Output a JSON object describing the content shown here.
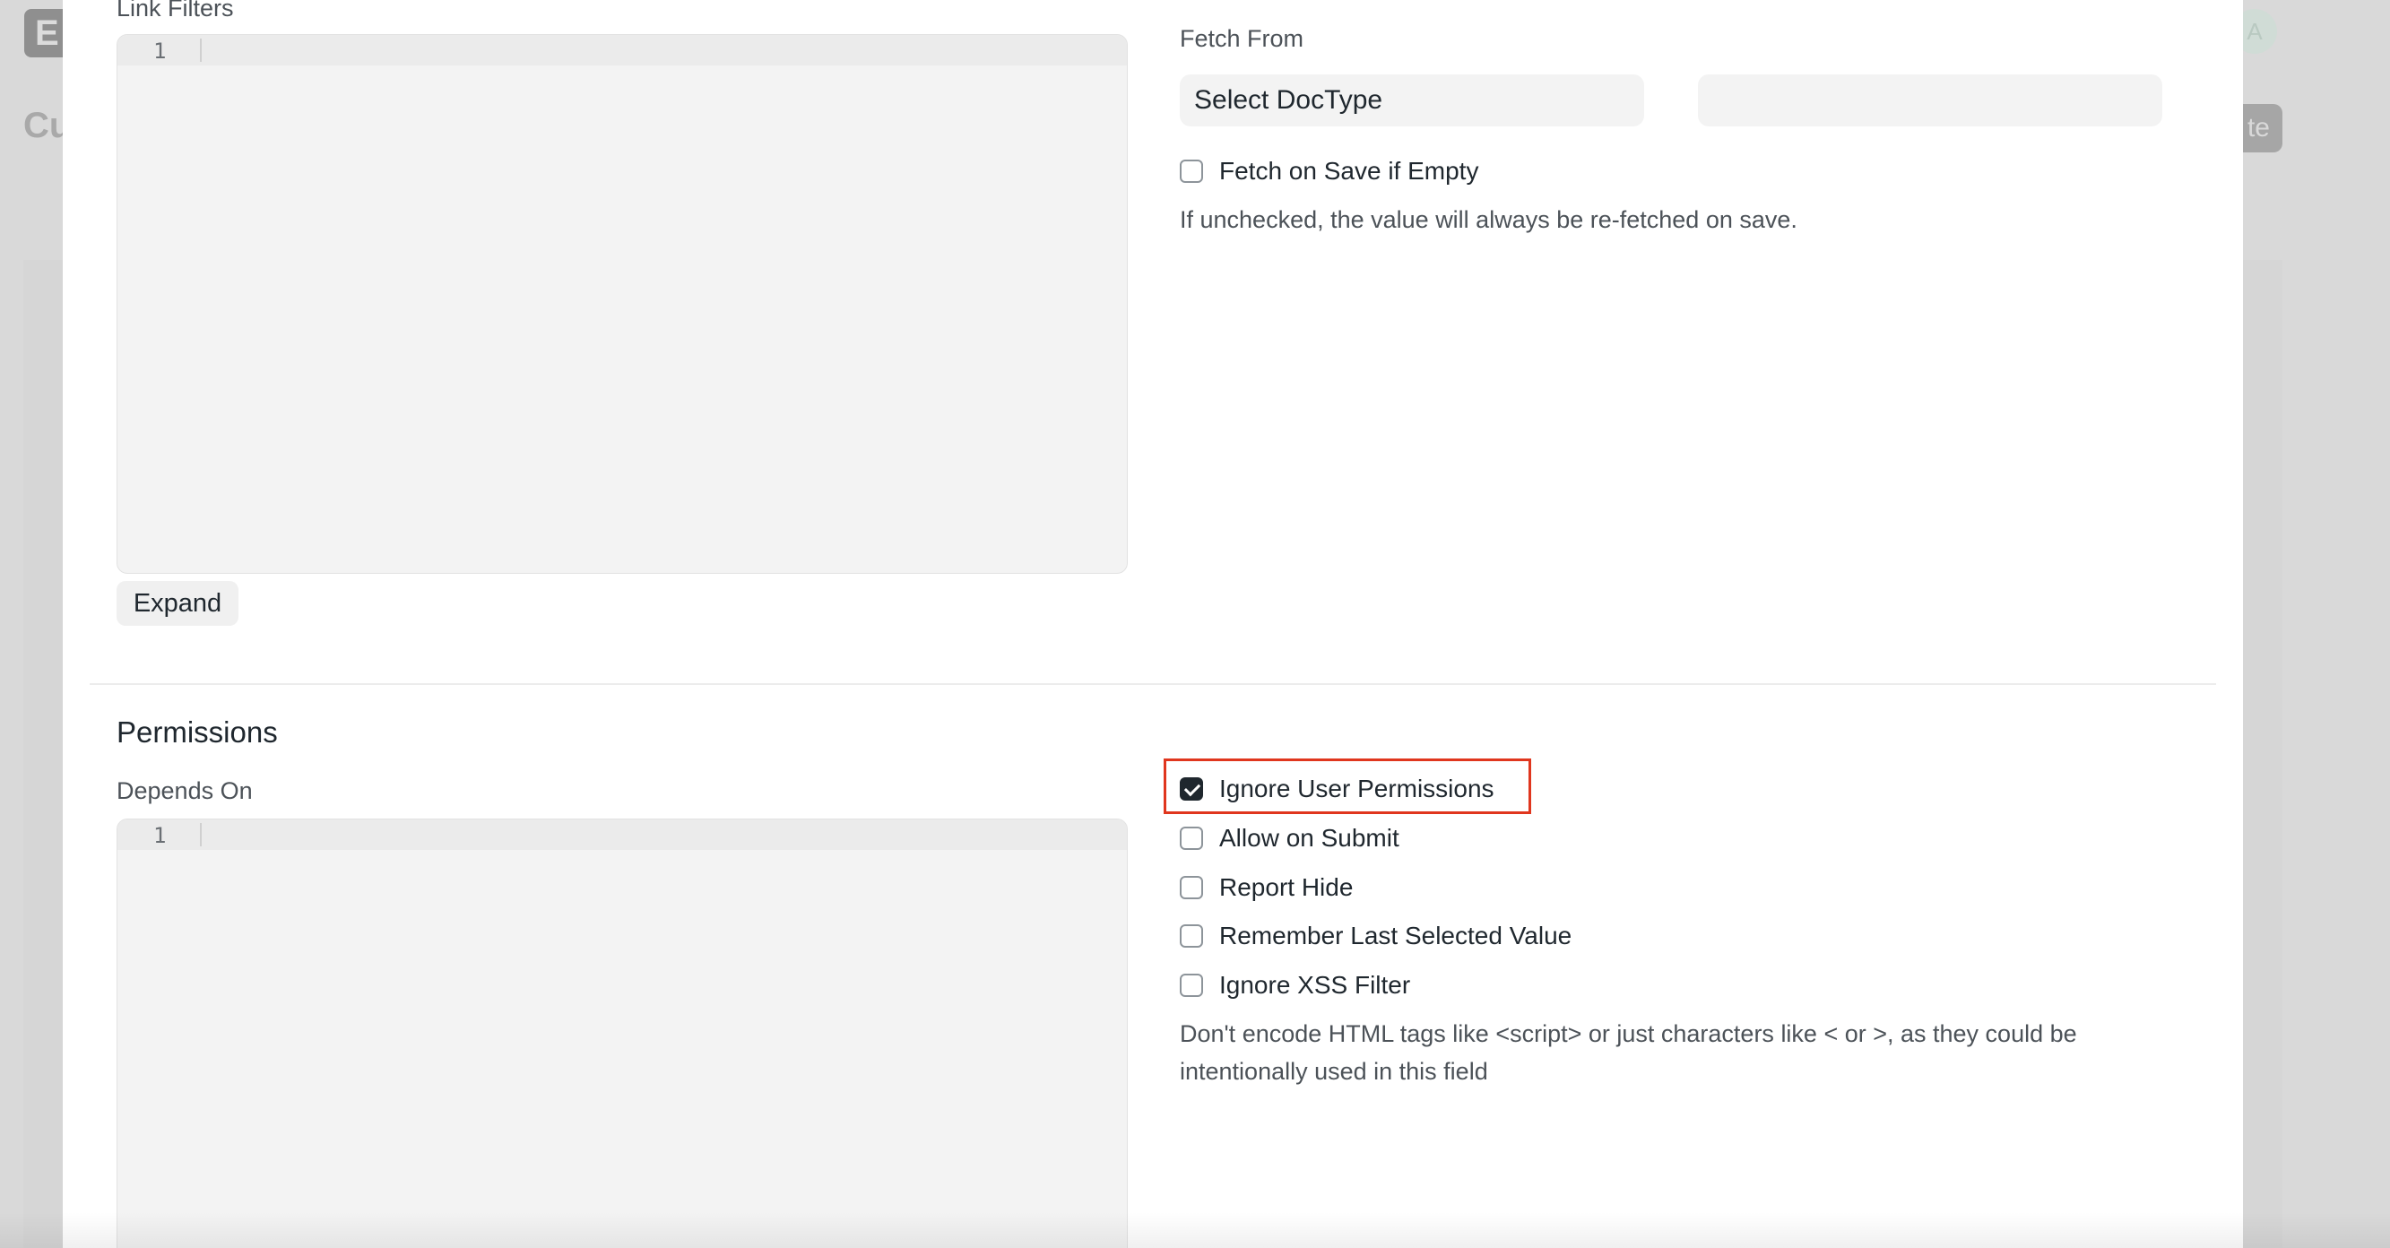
{
  "background": {
    "logo_letter": "E",
    "page_title": "Cu",
    "avatar_letter": "A",
    "action_button": "te"
  },
  "modal": {
    "link_filters": {
      "label": "Link Filters",
      "line_number": "1",
      "expand_button": "Expand"
    },
    "fetch_from": {
      "label": "Fetch From",
      "doctype_placeholder": "Select DocType",
      "field_value": ""
    },
    "fetch_on_save": {
      "label": "Fetch on Save if Empty",
      "checked": false,
      "help": "If unchecked, the value will always be re-fetched on save."
    },
    "permissions": {
      "title": "Permissions",
      "depends_on": {
        "label": "Depends On",
        "line_number": "1"
      },
      "checkboxes": [
        {
          "label": "Ignore User Permissions",
          "checked": true
        },
        {
          "label": "Allow on Submit",
          "checked": false
        },
        {
          "label": "Report Hide",
          "checked": false
        },
        {
          "label": "Remember Last Selected Value",
          "checked": false
        },
        {
          "label": "Ignore XSS Filter",
          "checked": false
        }
      ],
      "xss_help_line1": "Don't encode HTML tags like <script> or just characters like < or >, as they could be",
      "xss_help_line2": "intentionally used in this field"
    }
  },
  "colors": {
    "highlight": "#e0361e",
    "checked": "#1f272e"
  }
}
